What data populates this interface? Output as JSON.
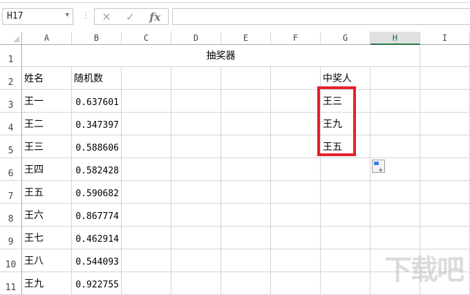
{
  "name_box": "H17",
  "formula_bar": {
    "cancel_icon": "✕",
    "enter_icon": "✓",
    "fx_label": "fx",
    "value": ""
  },
  "columns": [
    "A",
    "B",
    "C",
    "D",
    "E",
    "F",
    "G",
    "H",
    "I"
  ],
  "selected_column": "H",
  "rows": [
    "1",
    "2",
    "3",
    "4",
    "5",
    "6",
    "7",
    "8",
    "9",
    "10",
    "11"
  ],
  "title": "抽奖器",
  "headers": {
    "name": "姓名",
    "random": "随机数",
    "winner": "中奖人"
  },
  "people": [
    {
      "name": "王一",
      "value": "0.637601"
    },
    {
      "name": "王二",
      "value": "0.347397"
    },
    {
      "name": "王三",
      "value": "0.588606"
    },
    {
      "name": "王四",
      "value": "0.582428"
    },
    {
      "name": "王五",
      "value": "0.590682"
    },
    {
      "name": "王六",
      "value": "0.867774"
    },
    {
      "name": "王七",
      "value": "0.462914"
    },
    {
      "name": "王八",
      "value": "0.544093"
    },
    {
      "name": "王九",
      "value": "0.922755"
    }
  ],
  "winners": [
    "王三",
    "王九",
    "王五"
  ],
  "highlight_color": "#e8202a",
  "watermark": "下载吧"
}
